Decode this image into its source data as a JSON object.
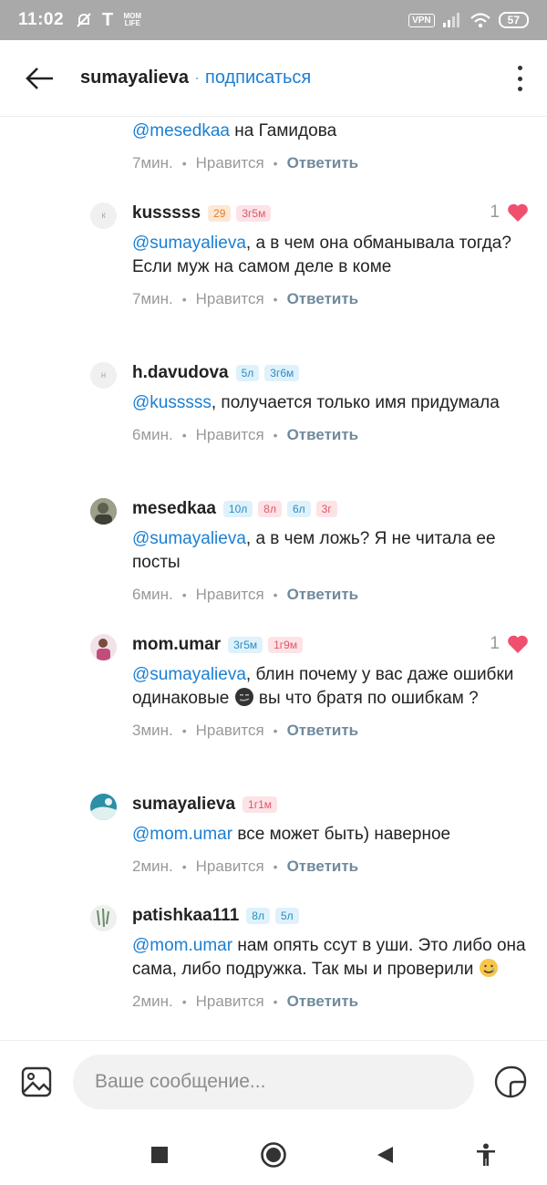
{
  "status_bar": {
    "time": "11:02",
    "vpn": "VPN",
    "battery": "57",
    "mom_life": "MOM LIFE",
    "t_icon": "T"
  },
  "header": {
    "username": "sumayalieva",
    "separator": "·",
    "subscribe_label": "подписаться"
  },
  "partial_comment": {
    "mention": "@mesedkaa",
    "text": " на Гамидова",
    "time": "7мин.",
    "like_label": "Нравится",
    "reply_label": "Ответить"
  },
  "comments": [
    {
      "username": "kusssss",
      "avatar_letter": "к",
      "badges": [
        {
          "text": "29",
          "color": "orange"
        },
        {
          "text": "3г5м",
          "color": "pink"
        }
      ],
      "mention": "@sumayalieva",
      "text_1": ", а в чем она обманывала тогда?",
      "text_2": "Если муж на самом деле в коме",
      "time": "7мин.",
      "like_label": "Нравится",
      "reply_label": "Ответить",
      "likes": "1"
    },
    {
      "username": "h.davudova",
      "avatar_letter": "н",
      "badges": [
        {
          "text": "5л",
          "color": "blue"
        },
        {
          "text": "3г6м",
          "color": "blue"
        }
      ],
      "mention": "@kusssss",
      "text_1": ", получается только имя придумала",
      "time": "6мин.",
      "like_label": "Нравится",
      "reply_label": "Ответить"
    },
    {
      "username": "mesedkaa",
      "badges": [
        {
          "text": "10л",
          "color": "blue"
        },
        {
          "text": "8л",
          "color": "pink"
        },
        {
          "text": "6л",
          "color": "blue"
        },
        {
          "text": "3г",
          "color": "pink"
        }
      ],
      "mention": "@sumayalieva",
      "text_1": ", а в чем ложь? Я не читала ее посты",
      "time": "6мин.",
      "like_label": "Нравится",
      "reply_label": "Ответить"
    },
    {
      "username": "mom.umar",
      "badges": [
        {
          "text": "3г5м",
          "color": "blue"
        },
        {
          "text": "1г9м",
          "color": "pink"
        }
      ],
      "mention": "@sumayalieva",
      "text_1": ", блин почему у вас даже ошибки одинаковые ",
      "text_2": " вы что братя по ошибкам ?",
      "time": "3мин.",
      "like_label": "Нравится",
      "reply_label": "Ответить",
      "likes": "1"
    },
    {
      "username": "sumayalieva",
      "badges": [
        {
          "text": "1г1м",
          "color": "pink"
        }
      ],
      "mention": "@mom.umar",
      "text_1": " все может быть) наверное",
      "time": "2мин.",
      "like_label": "Нравится",
      "reply_label": "Ответить"
    },
    {
      "username": "patishkaa111",
      "badges": [
        {
          "text": "8л",
          "color": "blue"
        },
        {
          "text": "5л",
          "color": "blue"
        }
      ],
      "mention": "@mom.umar",
      "text_1": " нам опять ссут в уши. Это либо она сама, либо подружка. Так мы и проверили ",
      "time": "2мин.",
      "like_label": "Нравится",
      "reply_label": "Ответить"
    }
  ],
  "input": {
    "placeholder": "Ваше сообщение..."
  },
  "colors": {
    "accent": "#1b7fd3",
    "heart": "#f0506e",
    "status_bar": "#a9a9a9"
  },
  "icons": [
    "back-arrow-icon",
    "more-vertical-icon",
    "heart-icon",
    "image-icon",
    "sticker-icon",
    "stop-icon",
    "home-icon",
    "back-triangle-icon",
    "accessibility-icon"
  ]
}
